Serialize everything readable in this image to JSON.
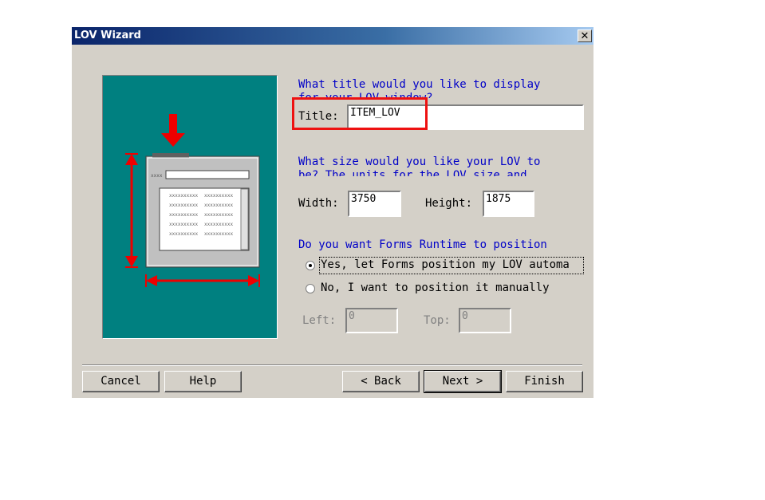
{
  "window": {
    "title": "LOV Wizard",
    "close_glyph": "✕"
  },
  "title_section": {
    "prompt_line1": "What title would you like to display",
    "prompt_line2": "for your LOV window?",
    "label": "Title:",
    "value": "ITEM_LOV"
  },
  "size_section": {
    "prompt_line1": "What size would you like your LOV to",
    "prompt_line2": "be? The units for the LOV size and",
    "width_label": "Width:",
    "width_value": "3750",
    "height_label": "Height:",
    "height_value": "1875"
  },
  "position_section": {
    "prompt": "Do you want Forms Runtime to position",
    "option_yes": "Yes, let Forms position my LOV automa",
    "option_no": "No, I want to position it manually",
    "selected": "yes",
    "left_label": "Left:",
    "left_value": "0",
    "top_label": "Top:",
    "top_value": "0"
  },
  "buttons": {
    "cancel": "Cancel",
    "help": "Help",
    "back": "< Back",
    "next": "Next >",
    "finish": "Finish"
  },
  "icons": [
    "close-icon",
    "down-arrow-icon",
    "vertical-dimension-arrow-icon",
    "horizontal-dimension-arrow-icon",
    "lov-window-illustration"
  ],
  "colors": {
    "illustration_bg": "#008080",
    "prompt_text": "#0000c8",
    "highlight": "#ee1111",
    "dialog_bg": "#d4d0c8"
  }
}
